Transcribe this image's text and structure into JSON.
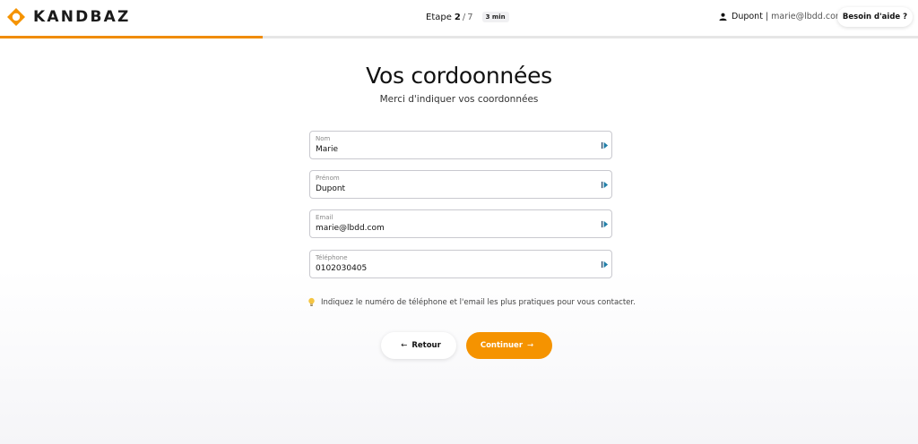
{
  "brand": {
    "name": "KANDBAZ",
    "color": "#f59300"
  },
  "header": {
    "step_label": "Etape",
    "step_current": "2",
    "step_separator": "/",
    "step_total": "7",
    "time_estimate": "3 min",
    "user_name": "Dupont",
    "user_separator": "|",
    "user_email": "marie@lbdd.com",
    "help_label": "Besoin d'aide ?"
  },
  "progress": {
    "fraction": 0.2857
  },
  "page": {
    "title": "Vos cordoonnées",
    "subtitle": "Merci d'indiquer vos coordonnées"
  },
  "form": {
    "fields": [
      {
        "label": "Nom",
        "value": "Marie"
      },
      {
        "label": "Prénom",
        "value": "Dupont"
      },
      {
        "label": "Email",
        "value": "marie@lbdd.com"
      },
      {
        "label": "Téléphone",
        "value": "0102030405"
      }
    ],
    "hint": "Indiquez le numéro de téléphone et l'email les plus pratiques pour vous contacter."
  },
  "actions": {
    "back_label": "Retour",
    "back_icon": "←",
    "continue_label": "Continuer",
    "continue_icon": "→"
  },
  "icons": {
    "logo": "kandbaz-logo-icon",
    "user": "user-icon",
    "autofill": "autofill-icon",
    "hint": "lightbulb-icon"
  }
}
